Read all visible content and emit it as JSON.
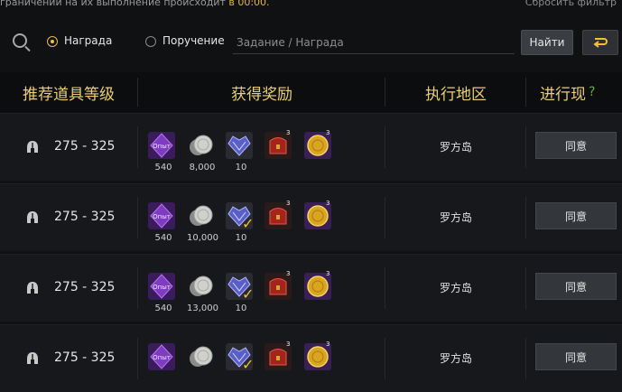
{
  "top_notice": {
    "text": "граничении на их выполнение происходит",
    "highlight": "в 00:00.",
    "right_text": "Сбросить фильтр"
  },
  "search": {
    "options": [
      {
        "label": "Награда",
        "selected": true
      },
      {
        "label": "Поручение",
        "selected": false
      }
    ],
    "placeholder": "Задание / Награда",
    "find_label": "Найти"
  },
  "columns": {
    "level": "推荐道具等级",
    "rewards": "获得奖励",
    "region": "执行地区",
    "action": "进行现",
    "help": "?"
  },
  "colors": {
    "accent": "#e8cf75",
    "exp_purple": "#6a2fa6",
    "gold": "#d5a019"
  },
  "rows": [
    {
      "level": "275 - 325",
      "rewards": [
        {
          "icon": "exp-crystal-icon",
          "label": "Опыт",
          "qty": "540"
        },
        {
          "icon": "silver-coin-icon",
          "qty": "8,000"
        },
        {
          "icon": "heart-gem-icon",
          "qty": "10",
          "checked": false
        },
        {
          "icon": "red-chest-icon",
          "badge": "3",
          "qty": ""
        },
        {
          "icon": "gold-coin-icon",
          "badge": "3",
          "qty": ""
        }
      ],
      "region": "罗方岛",
      "action": "同意"
    },
    {
      "level": "275 - 325",
      "rewards": [
        {
          "icon": "exp-crystal-icon",
          "label": "Опыт",
          "qty": "540"
        },
        {
          "icon": "silver-coin-icon",
          "qty": "10,000"
        },
        {
          "icon": "heart-gem-icon",
          "qty": "10",
          "checked": true
        },
        {
          "icon": "red-chest-icon",
          "badge": "3",
          "qty": ""
        },
        {
          "icon": "gold-coin-icon",
          "badge": "3",
          "qty": ""
        }
      ],
      "region": "罗方岛",
      "action": "同意"
    },
    {
      "level": "275 - 325",
      "rewards": [
        {
          "icon": "exp-crystal-icon",
          "label": "Опыт",
          "qty": "540"
        },
        {
          "icon": "silver-coin-icon",
          "qty": "13,000"
        },
        {
          "icon": "heart-gem-icon",
          "qty": "10",
          "checked": true
        },
        {
          "icon": "red-chest-icon",
          "badge": "3",
          "qty": ""
        },
        {
          "icon": "gold-coin-icon",
          "badge": "3",
          "qty": ""
        }
      ],
      "region": "罗方岛",
      "action": "同意"
    },
    {
      "level": "275 - 325",
      "rewards": [
        {
          "icon": "exp-crystal-icon",
          "label": "Опыт",
          "qty": ""
        },
        {
          "icon": "silver-coin-icon",
          "qty": ""
        },
        {
          "icon": "heart-gem-icon",
          "qty": "",
          "checked": true
        },
        {
          "icon": "red-chest-icon",
          "badge": "3",
          "qty": ""
        },
        {
          "icon": "gold-coin-icon",
          "badge": "3",
          "qty": ""
        }
      ],
      "region": "罗方岛",
      "action": "同意"
    }
  ]
}
